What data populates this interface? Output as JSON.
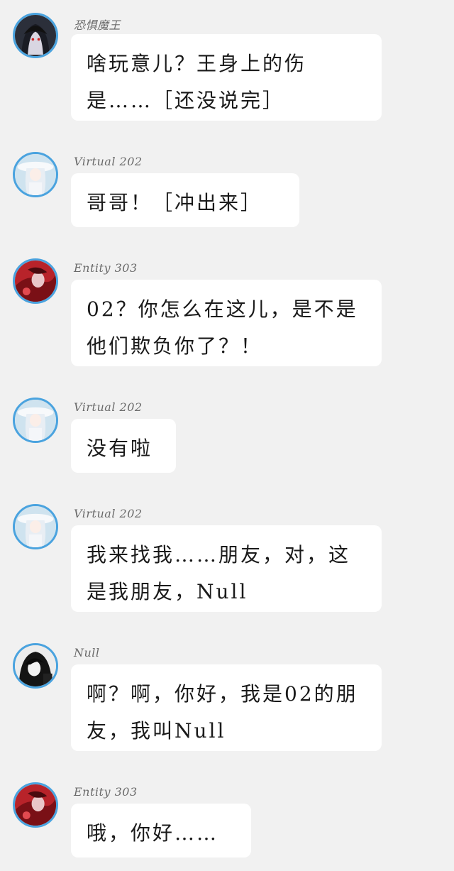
{
  "messages": [
    {
      "sender": "恐惧魔王",
      "avatar_icon": "dark-hooded-avatar-icon",
      "text": "啥玩意儿？王身上的伤是……［还没说完］"
    },
    {
      "sender": "Virtual 202",
      "avatar_icon": "white-hat-girl-avatar-icon",
      "text": "哥哥！［冲出来］"
    },
    {
      "sender": "Entity 303",
      "avatar_icon": "red-figure-avatar-icon",
      "text": "02？你怎么在这儿，是不是他们欺负你了？！"
    },
    {
      "sender": "Virtual 202",
      "avatar_icon": "white-hat-girl-avatar-icon",
      "text": "没有啦"
    },
    {
      "sender": "Virtual 202",
      "avatar_icon": "white-hat-girl-avatar-icon",
      "text": "我来找我……朋友，对，这是我朋友，Null"
    },
    {
      "sender": "Null",
      "avatar_icon": "black-hair-boy-avatar-icon",
      "text": "啊？啊，你好，我是02的朋友，我叫Null"
    },
    {
      "sender": "Entity 303",
      "avatar_icon": "red-figure-avatar-icon",
      "text": "哦，你好……"
    }
  ]
}
